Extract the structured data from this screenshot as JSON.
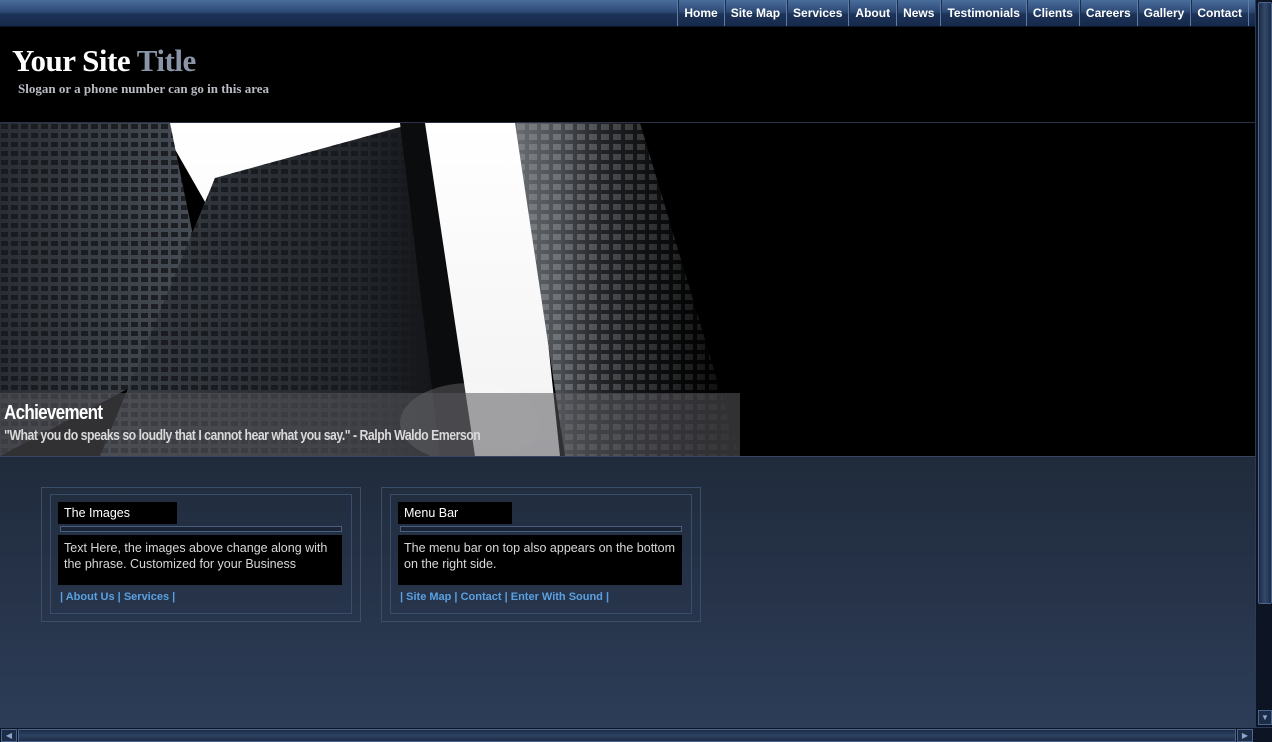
{
  "nav": {
    "items": [
      "Home",
      "Site Map",
      "Services",
      "About",
      "News",
      "Testimonials",
      "Clients",
      "Careers",
      "Gallery",
      "Contact"
    ]
  },
  "header": {
    "title_main": "Your Site",
    "title_accent": "Title",
    "slogan": "Slogan or a phone number can go in this area"
  },
  "banner": {
    "heading": "Achievement",
    "quote": "\"What you do speaks so loudly that I cannot hear what you say.\" - Ralph Waldo Emerson"
  },
  "boxes": [
    {
      "title": "The Images",
      "text": "Text Here, the images above change along with the phrase. Customized for your Business",
      "links": [
        "About Us",
        "Services"
      ]
    },
    {
      "title": "Menu Bar",
      "text": "The menu bar on top also appears on the bottom on the right side.",
      "links": [
        "Site Map",
        "Contact",
        "Enter With Sound"
      ]
    }
  ],
  "colors": {
    "nav_bar": "#2d4a75",
    "content_bg": "#263349",
    "link": "#5aa0e0"
  }
}
